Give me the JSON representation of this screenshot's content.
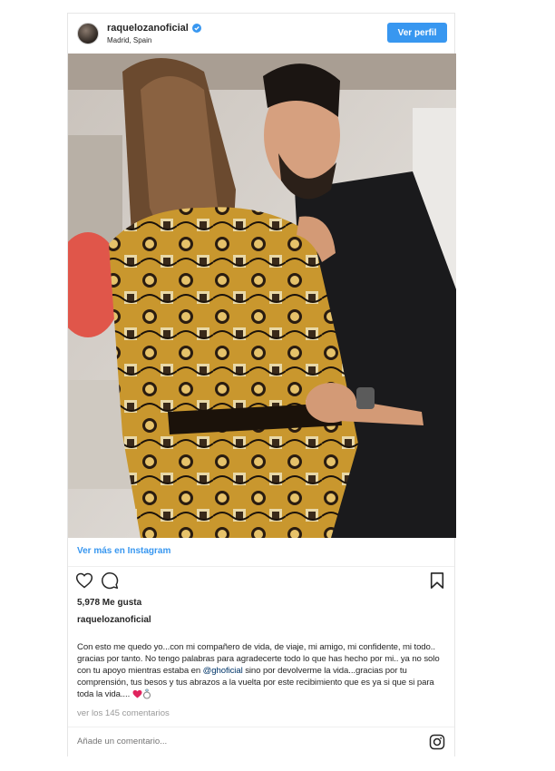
{
  "header": {
    "username": "raquelozanoficial",
    "location": "Madrid, Spain",
    "profile_button": "Ver perfil"
  },
  "photo": {
    "description_icon": "photo"
  },
  "link": {
    "ver_mas": "Ver más en Instagram"
  },
  "actions": {
    "like_icon": "heart-outline",
    "comment_icon": "comment-outline",
    "save_icon": "bookmark-outline"
  },
  "likes": "5,978 Me gusta",
  "post_user": "raquelozanoficial",
  "caption": {
    "part1": "Con esto me quedo yo...con mi compañero de vida, de viaje, mi amigo, mi confidente, mi todo.. gracias por tanto. No tengo palabras para agradecerte todo lo que has hecho por mi.. ya no solo con tu apoyo mientras estaba en ",
    "mention": "@ghoficial",
    "part2": " sino por devolverme la vida...gracias por tu comprensión, tus besos y tus abrazos a la vuelta por este recibimiento que es ya si que si para toda la vida.... "
  },
  "view_comments": "ver los 145 comentarios",
  "comment_placeholder": "Añade un comentario...",
  "colors": {
    "accent": "#3897f0",
    "mention": "#003569",
    "muted": "#999999"
  }
}
